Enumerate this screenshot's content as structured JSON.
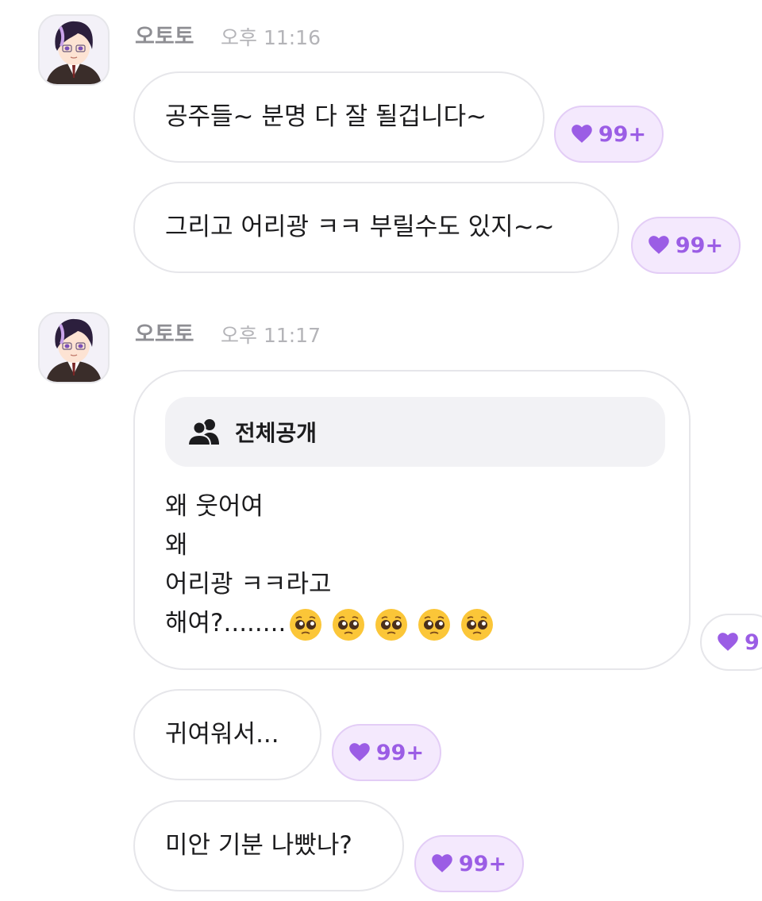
{
  "colors": {
    "accent": "#9b5de5",
    "like_bg": "#f4e9fd",
    "bubble_border": "#e6e6ea"
  },
  "groups": [
    {
      "sender": "오토토",
      "time": "오후 11:16",
      "messages": [
        {
          "text": "공주들~ 분명 다 잘 될겁니다~",
          "likes": "99+"
        },
        {
          "text": "그리고 어리광 ㅋㅋ 부릴수도 있지~~",
          "likes": "99+"
        }
      ]
    },
    {
      "sender": "오토토",
      "time": "오후 11:17",
      "card": {
        "visibility_icon": "people-icon",
        "visibility_label": "전체공개",
        "lines": [
          "왜 웃어여",
          "왜",
          "어리광 ㅋㅋ라고",
          "해여?........"
        ],
        "emoji": "pleading-face-icon",
        "emoji_count": 5,
        "likes": "9"
      },
      "messages": [
        {
          "text": "귀여워서...",
          "likes": "99+"
        },
        {
          "text": "미안 기분 나빴나?",
          "likes": "99+"
        }
      ]
    }
  ]
}
